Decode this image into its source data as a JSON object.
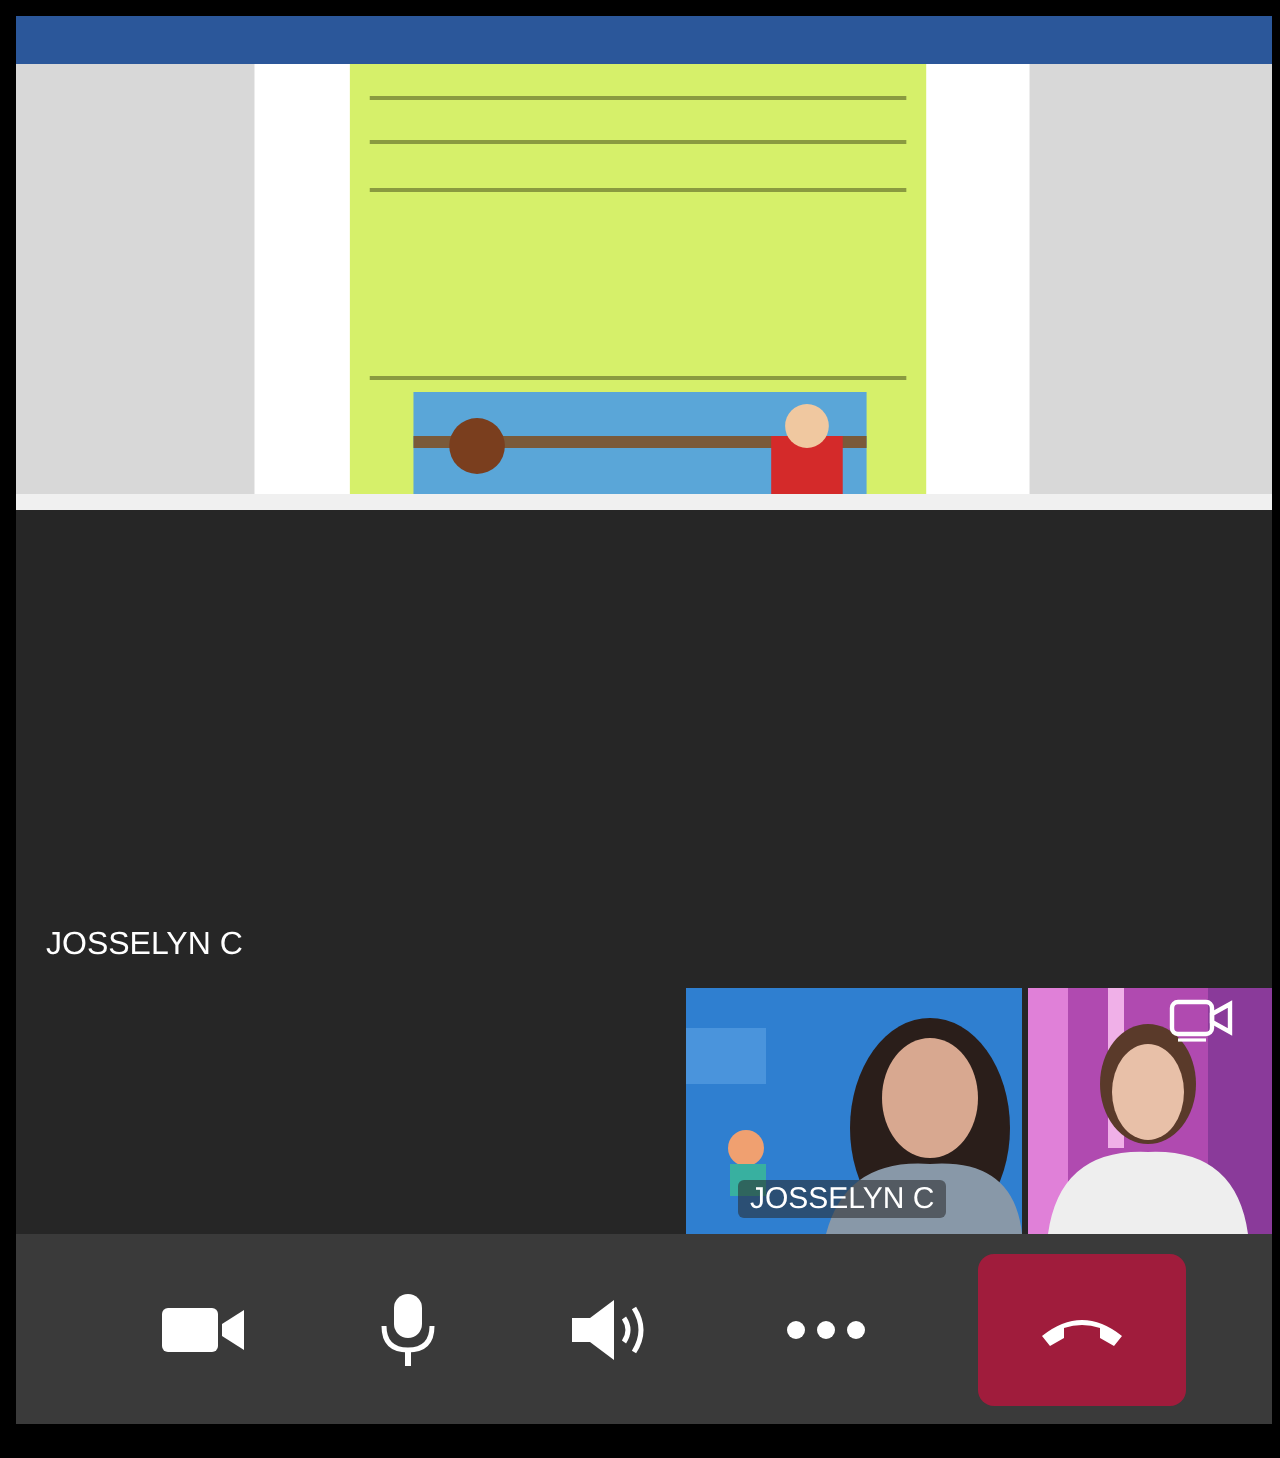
{
  "shared_screen": {
    "kind": "picture"
  },
  "participant_label": "JOSSELYN C",
  "video_tiles": [
    {
      "kind": "picture",
      "name": "JOSSELYN C"
    },
    {
      "kind": "picture",
      "switch_camera": true
    }
  ],
  "controls": [
    {
      "kind": "camera"
    },
    {
      "kind": "microphone"
    },
    {
      "kind": "speaker"
    },
    {
      "kind": "more"
    },
    {
      "kind": "hang-up"
    }
  ]
}
